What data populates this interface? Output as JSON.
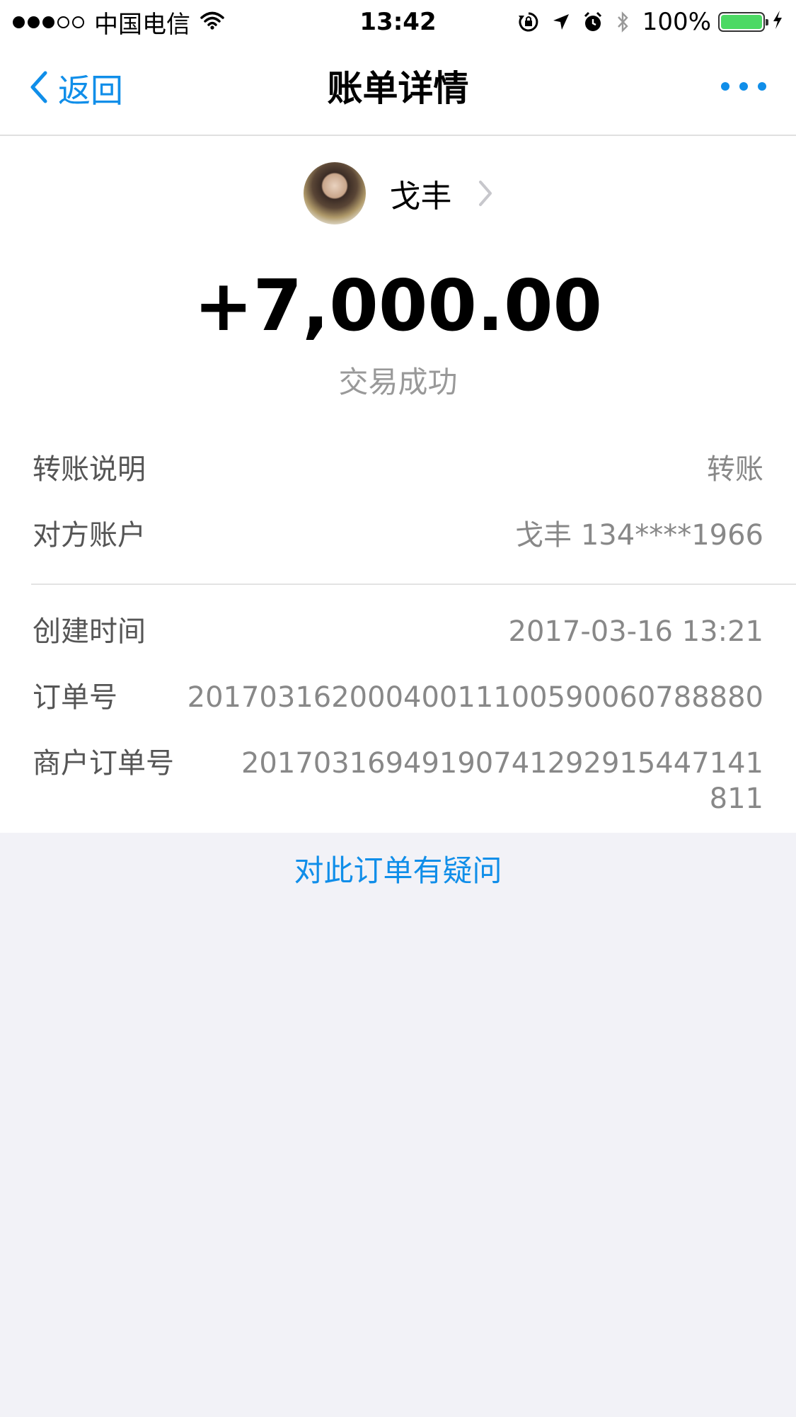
{
  "status_bar": {
    "carrier": "中国电信",
    "time": "13:42",
    "battery_percent": "100%",
    "battery_level": 1.0,
    "battery_color": "#4cd964",
    "icons": [
      "signal-dots",
      "wifi-icon",
      "rotation-lock-icon",
      "location-arrow-icon",
      "alarm-icon",
      "bluetooth-icon",
      "battery-icon",
      "charging-bolt-icon"
    ]
  },
  "nav": {
    "back_label": "返回",
    "title": "账单详情",
    "more_icon": "more-dots-icon"
  },
  "payee": {
    "name": "戈丰",
    "avatar_icon": "avatar-photo",
    "chevron_icon": "chevron-right-icon"
  },
  "amount": "+7,000.00",
  "status": "交易成功",
  "details": {
    "transfer_note": {
      "label": "转账说明",
      "value": "转账"
    },
    "counterparty": {
      "label": "对方账户",
      "value": "戈丰 134****1966"
    },
    "created_time": {
      "label": "创建时间",
      "value": "2017-03-16 13:21"
    },
    "order_no": {
      "label": "订单号",
      "value": "20170316200040011100590060788880"
    },
    "merchant_order_no": {
      "label": "商户订单号",
      "value": "20170316949190741292915447141811"
    }
  },
  "inquiry_link": "对此订单有疑问",
  "colors": {
    "accent": "#108ee9",
    "background": "#f2f2f7",
    "card": "#ffffff",
    "label_text": "#555555",
    "value_text": "#888888"
  }
}
